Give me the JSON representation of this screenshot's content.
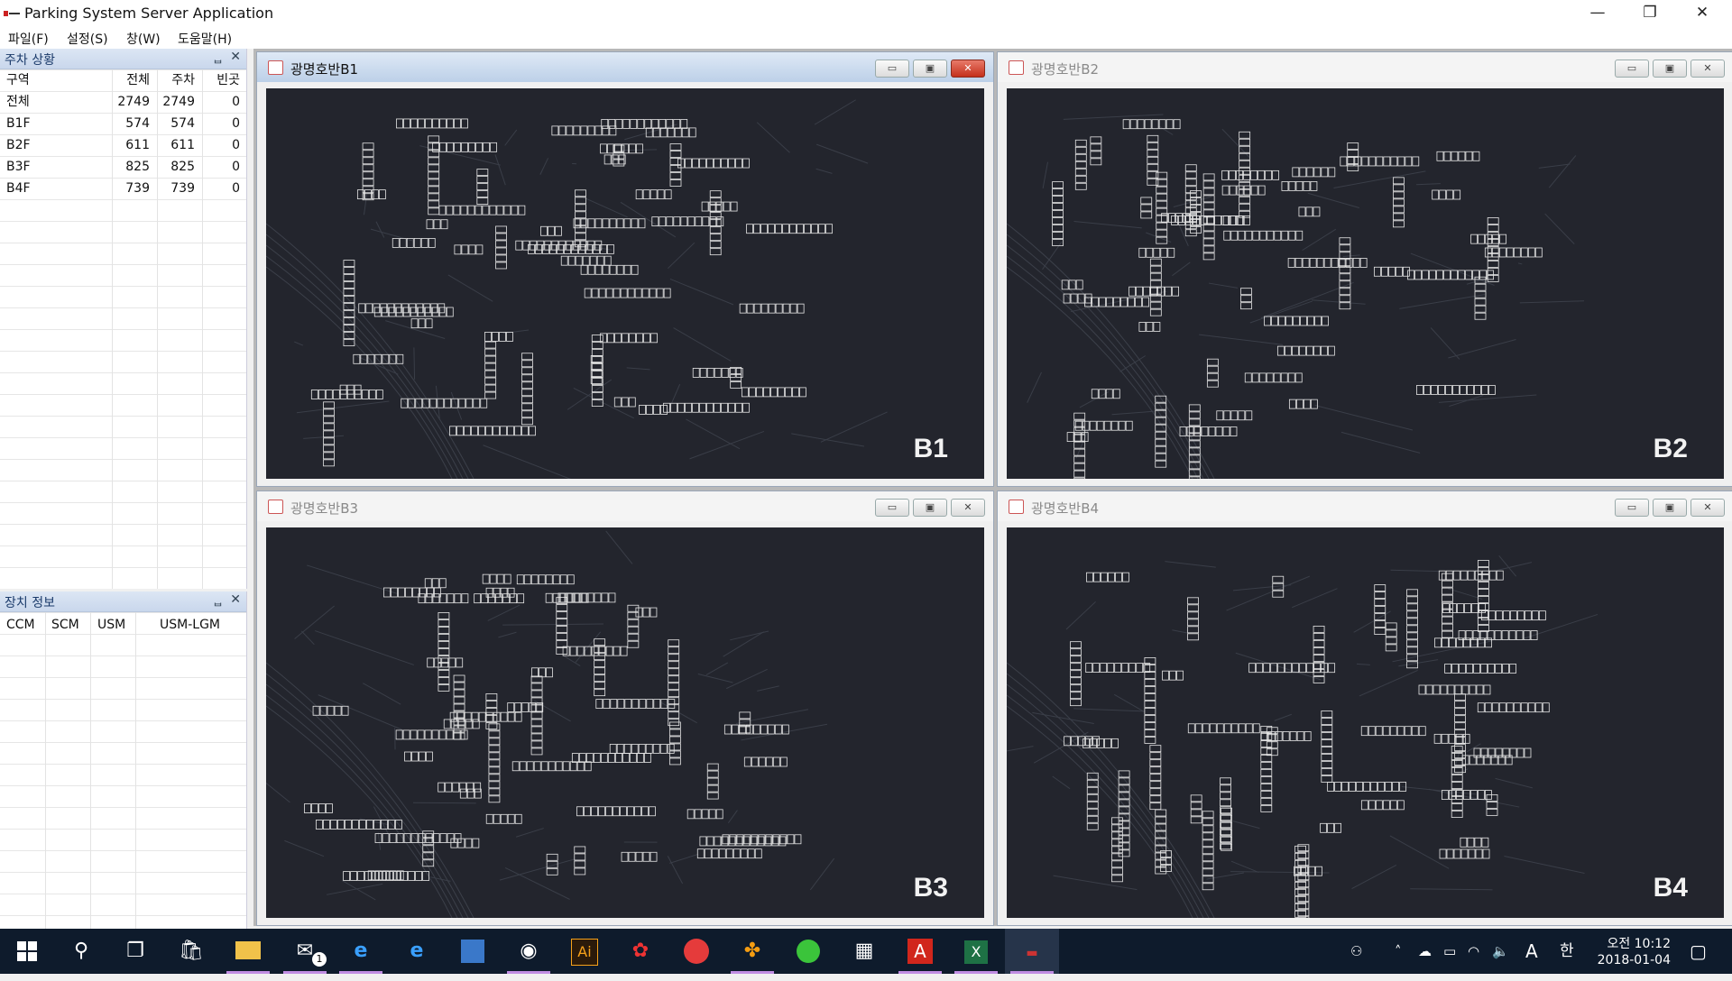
{
  "window": {
    "title": "Parking System Server Application",
    "minimize": "—",
    "restore": "❐",
    "close": "✕"
  },
  "menu": [
    "파일(F)",
    "설정(S)",
    "창(W)",
    "도움말(H)"
  ],
  "parking_panel": {
    "title": "주차 상황",
    "pin": "ᆸ",
    "close": "✕",
    "headers": [
      "구역",
      "전체",
      "주차",
      "빈곳"
    ],
    "rows": [
      [
        "전체",
        "2749",
        "2749",
        "0"
      ],
      [
        "B1F",
        "574",
        "574",
        "0"
      ],
      [
        "B2F",
        "611",
        "611",
        "0"
      ],
      [
        "B3F",
        "825",
        "825",
        "0"
      ],
      [
        "B4F",
        "739",
        "739",
        "0"
      ]
    ]
  },
  "device_panel": {
    "title": "장치 정보",
    "pin": "ᆸ",
    "close": "✕",
    "headers": [
      "CCM",
      "SCM",
      "USM",
      "USM-LGM"
    ]
  },
  "child_windows": [
    {
      "title": "광명호반B1",
      "floor": "B1",
      "active": true
    },
    {
      "title": "광명호반B2",
      "floor": "B2",
      "active": false
    },
    {
      "title": "광명호반B3",
      "floor": "B3",
      "active": false
    },
    {
      "title": "광명호반B4",
      "floor": "B4",
      "active": false
    }
  ],
  "child_buttons": {
    "minimize": "▭",
    "maximize": "▣",
    "close": "✕"
  },
  "taskbar": {
    "apps": [
      "start-icon",
      "search-icon",
      "task-view-icon",
      "store-icon",
      "file-explorer-icon",
      "mail-icon",
      "edge-icon",
      "ie-icon",
      "app-icon",
      "camera-app-icon",
      "illustrator-icon",
      "app-red-icon",
      "app-red2-icon",
      "app-game-icon",
      "app-green-icon",
      "calculator-icon",
      "acrobat-icon",
      "excel-icon",
      "parking-app-icon"
    ],
    "ai_label": "Ai",
    "mail_badge": "1",
    "tray_ime": "A",
    "tray_lang": "한",
    "time": "오전 10:12",
    "date": "2018-01-04"
  }
}
